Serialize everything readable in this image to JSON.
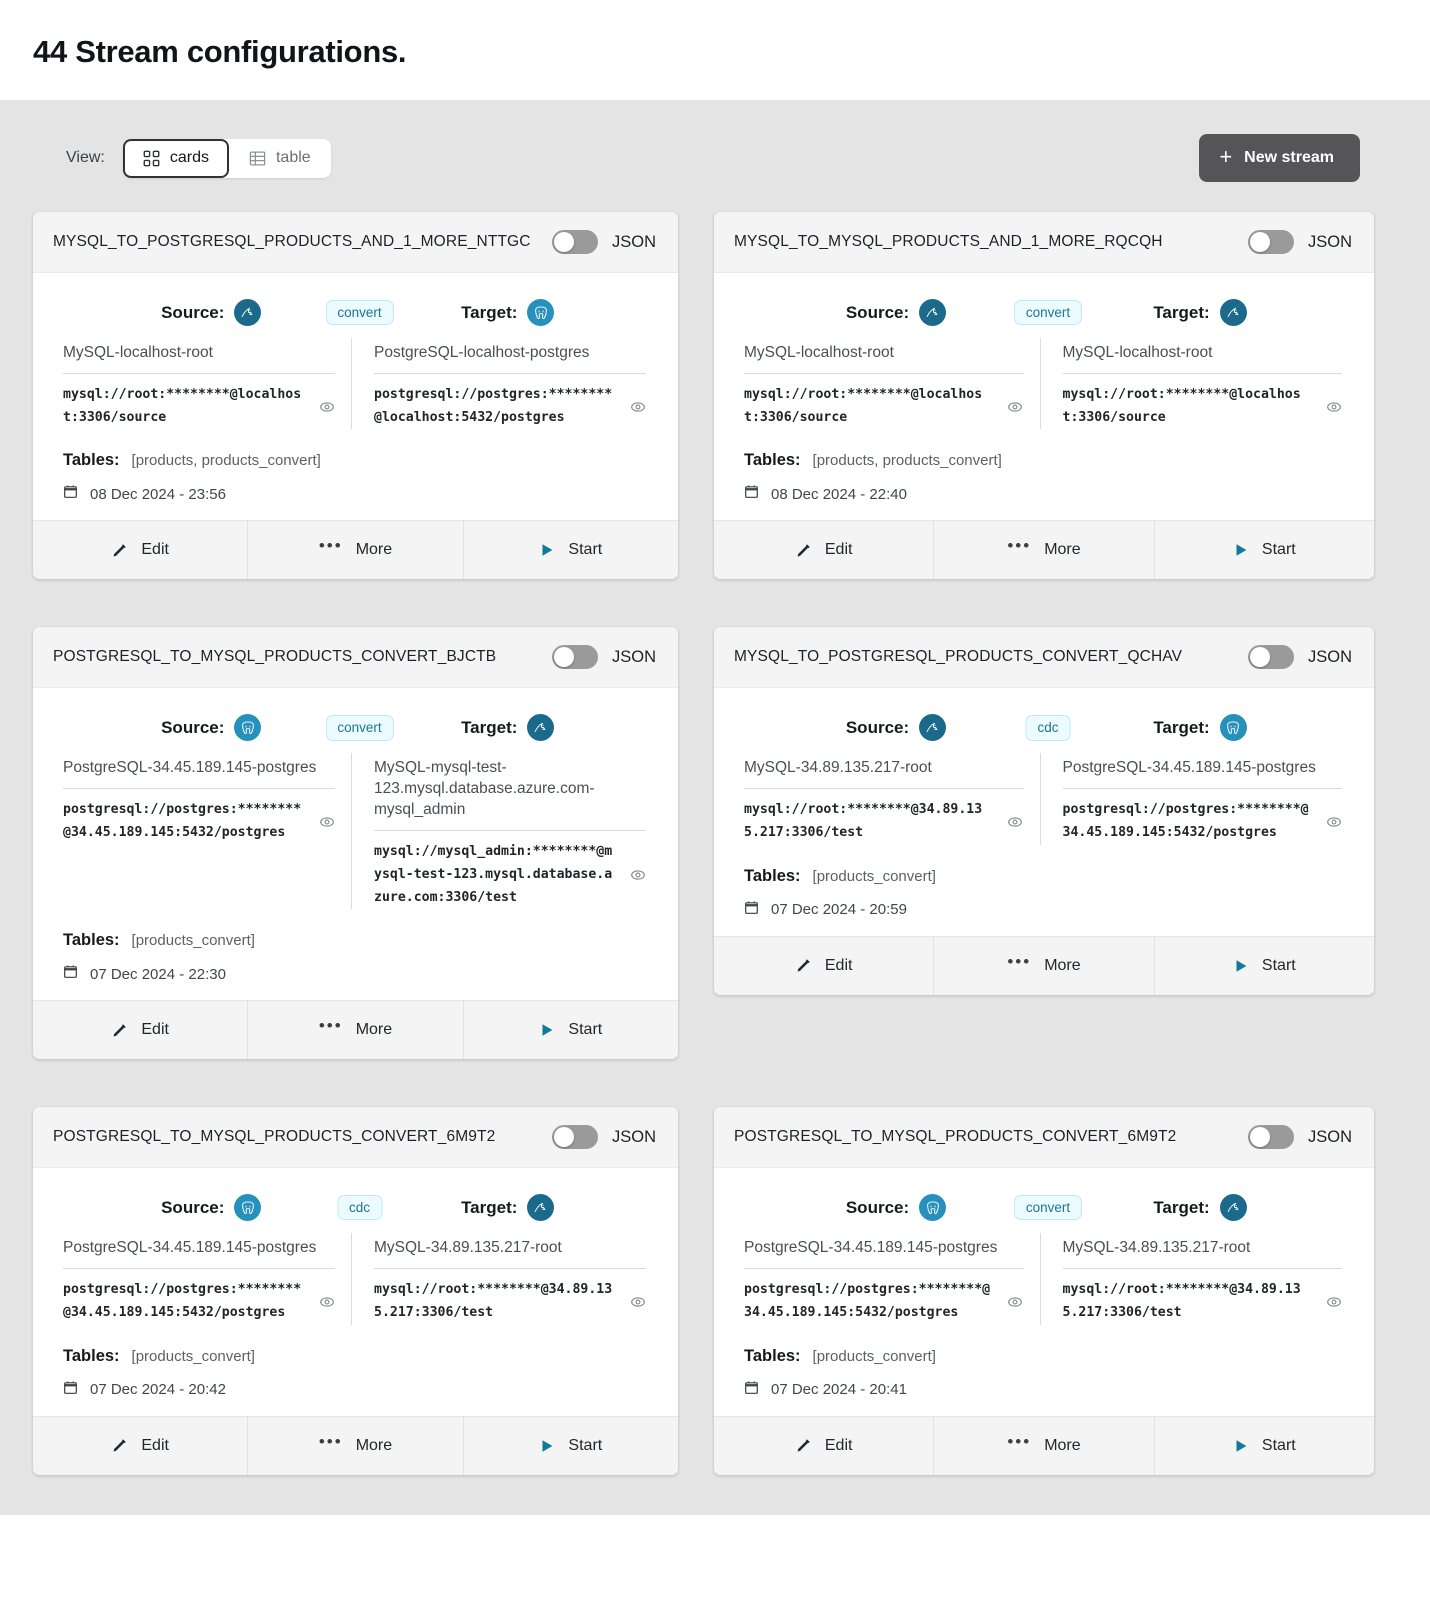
{
  "page": {
    "title": "44 Stream configurations."
  },
  "toolbar": {
    "view_label": "View:",
    "view_options": [
      {
        "label": "cards",
        "icon": "grid-icon",
        "active": true
      },
      {
        "label": "table",
        "icon": "table-icon",
        "active": false
      }
    ],
    "new_stream_label": "New stream",
    "new_stream_icon": "plus-icon"
  },
  "labels": {
    "source": "Source:",
    "target": "Target:",
    "tables": "Tables:",
    "json": "JSON",
    "edit": "Edit",
    "more": "More",
    "start": "Start"
  },
  "colors": {
    "accent": "#107a9b",
    "badge_bg": "#ecfbff",
    "badge_text": "#1b7694",
    "mysql_icon": "#1b6a8c",
    "postgres_icon": "#2790bd",
    "page_bg": "#e4e4e4",
    "button_dark": "#555558"
  },
  "cards": [
    {
      "title": "MYSQL_TO_POSTGRESQL_PRODUCTS_AND_1_MORE_NTTGC",
      "json_enabled": false,
      "badge": "convert",
      "source": {
        "db": "mysql",
        "name": "MySQL-localhost-root",
        "uri": "mysql://root:********@localhost:3306/source"
      },
      "target": {
        "db": "postgres",
        "name": "PostgreSQL-localhost-postgres",
        "uri": "postgresql://postgres:********@localhost:5432/postgres"
      },
      "tables": "[products, products_convert]",
      "date": "08 Dec 2024 - 23:56"
    },
    {
      "title": "MYSQL_TO_MYSQL_PRODUCTS_AND_1_MORE_RQCQH",
      "json_enabled": false,
      "badge": "convert",
      "source": {
        "db": "mysql",
        "name": "MySQL-localhost-root",
        "uri": "mysql://root:********@localhost:3306/source"
      },
      "target": {
        "db": "mysql",
        "name": "MySQL-localhost-root",
        "uri": "mysql://root:********@localhost:3306/source"
      },
      "tables": "[products, products_convert]",
      "date": "08 Dec 2024 - 22:40"
    },
    {
      "title": "POSTGRESQL_TO_MYSQL_PRODUCTS_CONVERT_BJCTB",
      "json_enabled": false,
      "badge": "convert",
      "source": {
        "db": "postgres",
        "name": "PostgreSQL-34.45.189.145-postgres",
        "uri": "postgresql://postgres:********@34.45.189.145:5432/postgres"
      },
      "target": {
        "db": "mysql",
        "name": "MySQL-mysql-test-123.mysql.database.azure.com-mysql_admin",
        "uri": "mysql://mysql_admin:********@mysql-test-123.mysql.database.azure.com:3306/test"
      },
      "tables": "[products_convert]",
      "date": "07 Dec 2024 - 22:30"
    },
    {
      "title": "MYSQL_TO_POSTGRESQL_PRODUCTS_CONVERT_QCHAV",
      "json_enabled": false,
      "badge": "cdc",
      "source": {
        "db": "mysql",
        "name": "MySQL-34.89.135.217-root",
        "uri": "mysql://root:********@34.89.135.217:3306/test"
      },
      "target": {
        "db": "postgres",
        "name": "PostgreSQL-34.45.189.145-postgres",
        "uri": "postgresql://postgres:********@34.45.189.145:5432/postgres"
      },
      "tables": "[products_convert]",
      "date": "07 Dec 2024 - 20:59"
    },
    {
      "title": "POSTGRESQL_TO_MYSQL_PRODUCTS_CONVERT_6M9T2",
      "json_enabled": false,
      "badge": "cdc",
      "source": {
        "db": "postgres",
        "name": "PostgreSQL-34.45.189.145-postgres",
        "uri": "postgresql://postgres:********@34.45.189.145:5432/postgres"
      },
      "target": {
        "db": "mysql",
        "name": "MySQL-34.89.135.217-root",
        "uri": "mysql://root:********@34.89.135.217:3306/test"
      },
      "tables": "[products_convert]",
      "date": "07 Dec 2024 - 20:42"
    },
    {
      "title": "POSTGRESQL_TO_MYSQL_PRODUCTS_CONVERT_6M9T2",
      "json_enabled": false,
      "badge": "convert",
      "source": {
        "db": "postgres",
        "name": "PostgreSQL-34.45.189.145-postgres",
        "uri": "postgresql://postgres:********@34.45.189.145:5432/postgres"
      },
      "target": {
        "db": "mysql",
        "name": "MySQL-34.89.135.217-root",
        "uri": "mysql://root:********@34.89.135.217:3306/test"
      },
      "tables": "[products_convert]",
      "date": "07 Dec 2024 - 20:41"
    }
  ]
}
